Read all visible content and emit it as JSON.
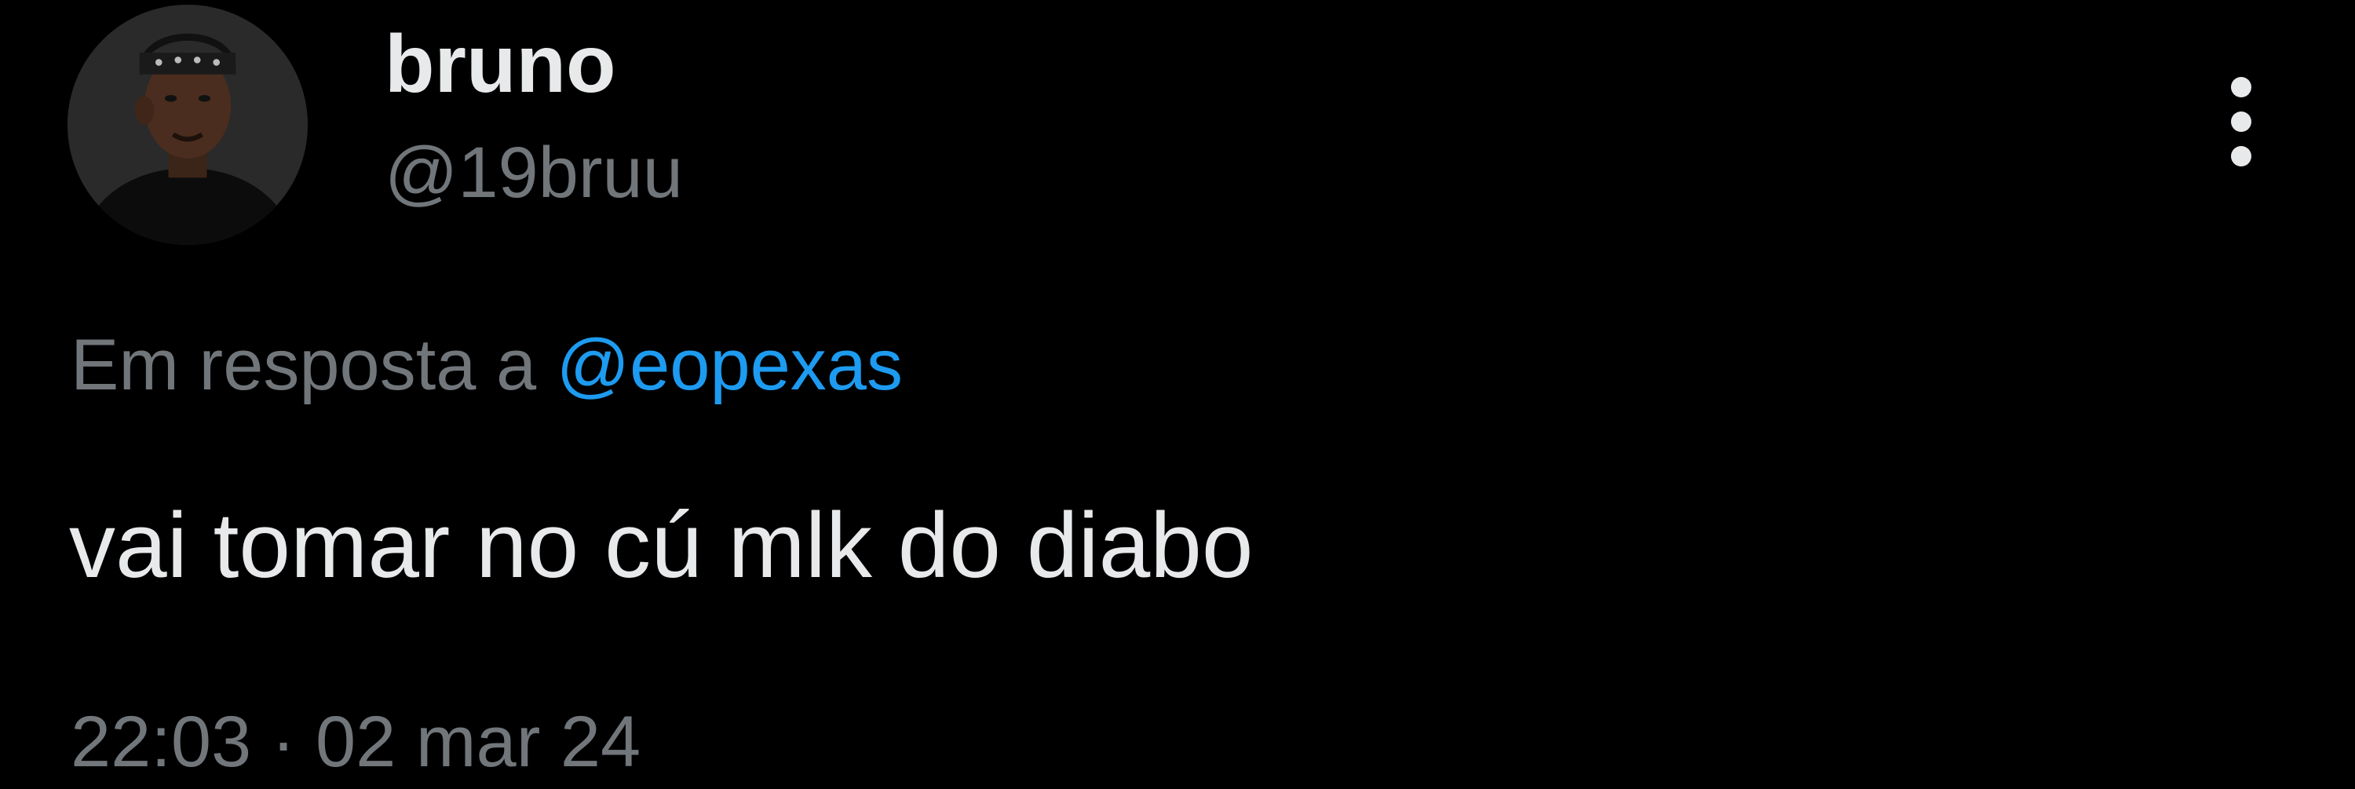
{
  "author": {
    "display_name": "bruno",
    "handle": "@19bruu",
    "avatar_icon": "profile-photo"
  },
  "reply": {
    "prefix": "Em resposta a",
    "mention": "@eopexas"
  },
  "tweet": {
    "text": "vai tomar no cú mlk do diabo"
  },
  "meta": {
    "time": "22:03",
    "separator": "·",
    "date": "02 mar 24"
  },
  "actions": {
    "more_icon": "vertical-ellipsis-icon"
  },
  "colors": {
    "background": "#000000",
    "primary_text": "#e7e9ea",
    "secondary_text": "#71767b",
    "link": "#1d9bf0"
  }
}
